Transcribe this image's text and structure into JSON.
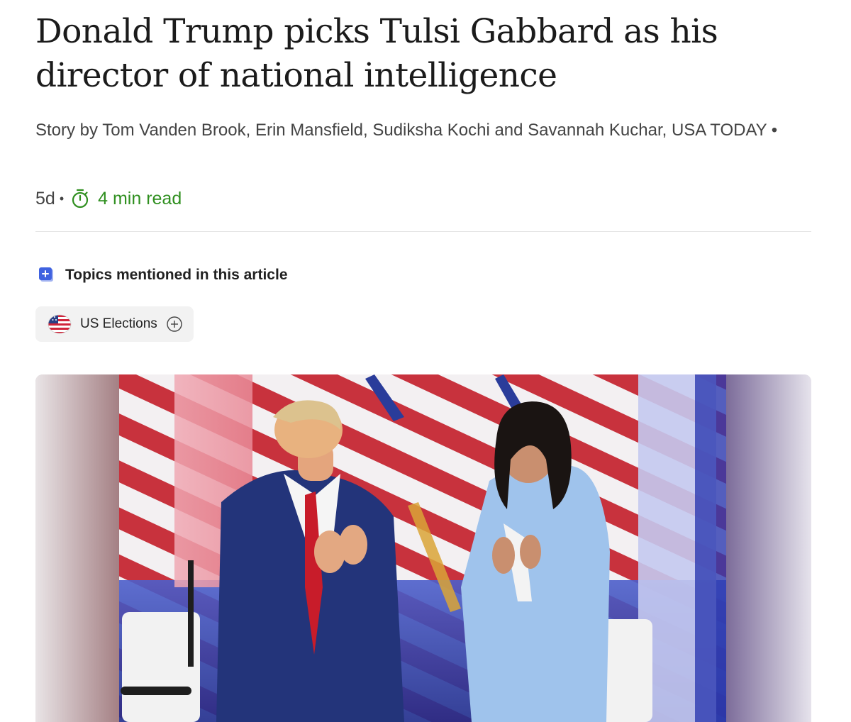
{
  "article": {
    "headline": "Donald Trump picks Tulsi Gabbard as his director of national intelligence",
    "byline": "Story by Tom Vanden Brook, Erin Mansfield, Sudiksha Kochi and Savannah Kuchar, USA TODAY",
    "byline_separator": "•",
    "age": "5d",
    "meta_separator": "•",
    "read_time": "4 min read"
  },
  "topics": {
    "heading": "Topics mentioned in this article",
    "items": [
      {
        "label": "US Elections",
        "icon": "us-flag-icon",
        "action_icon": "plus-circle-icon"
      }
    ]
  },
  "photo": {
    "description_icon": "hero-photo"
  },
  "colors": {
    "read_time_green": "#2f8f1f",
    "topic_icon_blue": "#3f62e0",
    "chip_background": "#f2f2f2"
  }
}
